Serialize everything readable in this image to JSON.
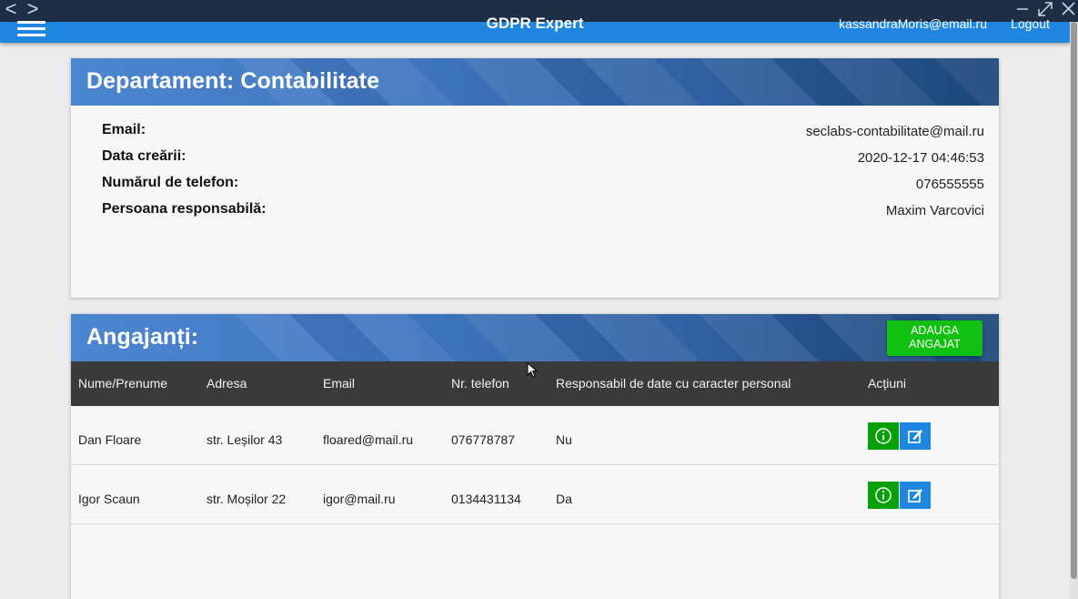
{
  "window": {
    "nav_back": "<",
    "nav_forward": ">"
  },
  "appbar": {
    "title": "GDPR Expert",
    "user_email": "kassandraMoris@email.ru",
    "logout_label": "Logout"
  },
  "department": {
    "heading": "Departament: Contabilitate",
    "fields": [
      {
        "label": "Email:",
        "value": "seclabs-contabilitate@mail.ru"
      },
      {
        "label": "Data creării:",
        "value": "2020-12-17 04:46:53"
      },
      {
        "label": "Numărul de telefon:",
        "value": "076555555"
      },
      {
        "label": "Persoana responsabilă:",
        "value": "Maxim Varcovici"
      }
    ]
  },
  "employees": {
    "heading": "Angajanți:",
    "add_button": "ADAUGA ANGAJAT",
    "columns": [
      "Nume/Prenume",
      "Adresa",
      "Email",
      "Nr. telefon",
      "Responsabil de date cu caracter personal",
      "Acțiuni"
    ],
    "rows": [
      {
        "name": "Dan Floare",
        "address": "str. Leșilor 43",
        "email": "floared@mail.ru",
        "phone": "076778787",
        "responsible": "Nu"
      },
      {
        "name": "Igor Scaun",
        "address": "str. Moșilor 22",
        "email": "igor@mail.ru",
        "phone": "0134431134",
        "responsible": "Da"
      }
    ]
  },
  "colors": {
    "appbar": "#1f87e0",
    "header_gradient_start": "#4d86d0",
    "header_gradient_end": "#1c4678",
    "add_button": "#11c011",
    "info_button": "#08a008",
    "edit_button": "#1f87e0",
    "table_head": "#3a3a3a"
  },
  "icons": {
    "info": "info-circle-icon",
    "edit": "edit-icon",
    "menu": "hamburger-menu-icon"
  }
}
